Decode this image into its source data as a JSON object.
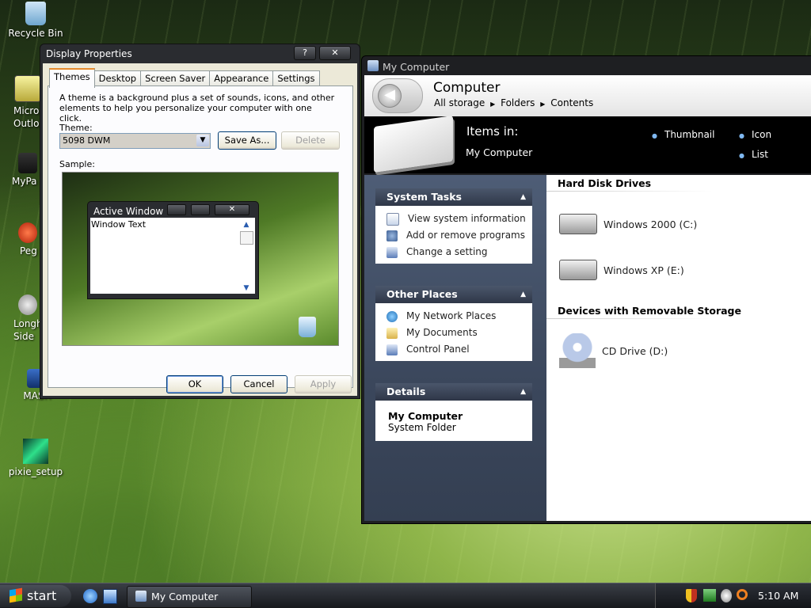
{
  "desktop": {
    "icons": [
      {
        "label": "Recycle Bin"
      },
      {
        "label": "Micro\nOutlo"
      },
      {
        "label": "MyPa"
      },
      {
        "label": "Peg"
      },
      {
        "label": "Longh\nSide"
      },
      {
        "label": "MASH"
      },
      {
        "label": "pixie_setup"
      }
    ]
  },
  "display_properties": {
    "title": "Display Properties",
    "help_btn": "?",
    "close_btn": "✕",
    "tabs": [
      "Themes",
      "Desktop",
      "Screen Saver",
      "Appearance",
      "Settings"
    ],
    "description": "A theme is a background plus a set of sounds, icons, and other elements to help you personalize your computer with one click.",
    "theme_label": "Theme:",
    "theme_value": "5098 DWM",
    "save_as": "Save As...",
    "delete": "Delete",
    "sample_label": "Sample:",
    "sample_window_title": "Active Window",
    "sample_window_text": "Window Text",
    "ok": "OK",
    "cancel": "Cancel",
    "apply": "Apply"
  },
  "my_computer": {
    "window_title": "My Computer",
    "heading": "Computer",
    "breadcrumb": [
      "All storage",
      "Folders",
      "Contents"
    ],
    "items_in_label": "Items in:",
    "items_in_value": "My Computer",
    "views": [
      "Thumbnail",
      "Icon",
      "List"
    ],
    "system_tasks": {
      "title": "System Tasks",
      "items": [
        "View system information",
        "Add or remove programs",
        "Change a setting"
      ]
    },
    "other_places": {
      "title": "Other Places",
      "items": [
        "My Network Places",
        "My Documents",
        "Control Panel"
      ]
    },
    "details": {
      "title": "Details",
      "name": "My Computer",
      "type": "System Folder"
    },
    "hdd_section": "Hard Disk Drives",
    "drives": [
      "Windows 2000 (C:)",
      "Windows XP (E:)"
    ],
    "removable_section": "Devices with Removable Storage",
    "cd_drive": "CD Drive (D:)"
  },
  "taskbar": {
    "start": "start",
    "task": "My Computer",
    "clock": "5:10 AM"
  }
}
